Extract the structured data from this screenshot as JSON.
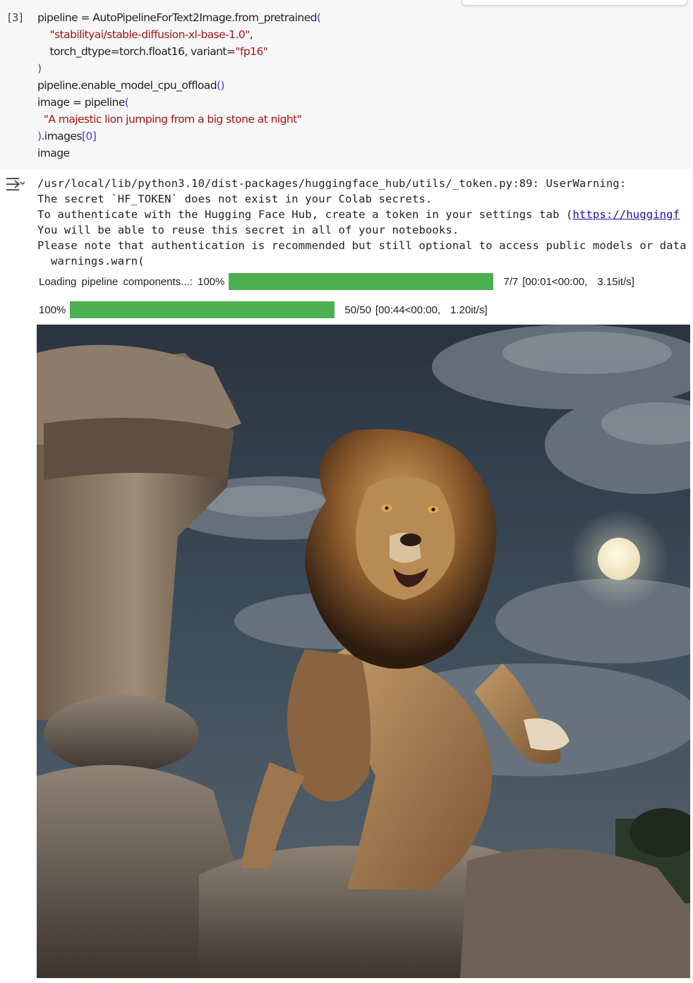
{
  "cell": {
    "execution_count": "[3]",
    "code": [
      [
        {
          "t": "pipeline = AutoPipelineForText2Image.from_pretrained",
          "c": "n"
        },
        {
          "t": "(",
          "c": "b"
        }
      ],
      [
        {
          "t": "    ",
          "c": "n"
        },
        {
          "t": "\"stabilityai/stable-diffusion-xl-base-1.0\"",
          "c": "s"
        },
        {
          "t": ",",
          "c": "n"
        }
      ],
      [
        {
          "t": "    torch_dtype=torch.float16, variant=",
          "c": "n"
        },
        {
          "t": "\"fp16\"",
          "c": "s"
        }
      ],
      [
        {
          "t": ")",
          "c": "b"
        }
      ],
      [
        {
          "t": "pipeline.enable_model_cpu_offload",
          "c": "n"
        },
        {
          "t": "()",
          "c": "b"
        }
      ],
      [
        {
          "t": "image = pipeline",
          "c": "n"
        },
        {
          "t": "(",
          "c": "b"
        }
      ],
      [
        {
          "t": "  ",
          "c": "n"
        },
        {
          "t": "\"A majestic lion jumping from a big stone at night\"",
          "c": "s"
        }
      ],
      [
        {
          "t": ")",
          "c": "b"
        },
        {
          "t": ".images",
          "c": "n"
        },
        {
          "t": "[0]",
          "c": "b"
        }
      ],
      [
        {
          "t": "image",
          "c": "n"
        }
      ]
    ]
  },
  "output": {
    "icon": "output-toggle-icon",
    "stderr_line1": "/usr/local/lib/python3.10/dist-packages/huggingface_hub/utils/_token.py:89: UserWarning: ",
    "stderr_line2": "The secret `HF_TOKEN` does not exist in your Colab secrets.",
    "stderr_line3_prefix": "To authenticate with the Hugging Face Hub, create a token in your settings tab (",
    "stderr_line3_link": "https://huggingf",
    "stderr_line4": "You will be able to reuse this secret in all of your notebooks.",
    "stderr_line5": "Please note that authentication is recommended but still optional to access public models or data",
    "stderr_line6": "  warnings.warn(",
    "progress1": {
      "label": "Loading pipeline components...: 100%",
      "fraction": 1.0,
      "count": "7/7",
      "timing": "[00:01<00:00,",
      "rate": "3.15it/s]"
    },
    "progress2": {
      "label": "100%",
      "fraction": 1.0,
      "count": "50/50",
      "timing": "[00:44<00:00,",
      "rate": "1.20it/s]"
    }
  }
}
